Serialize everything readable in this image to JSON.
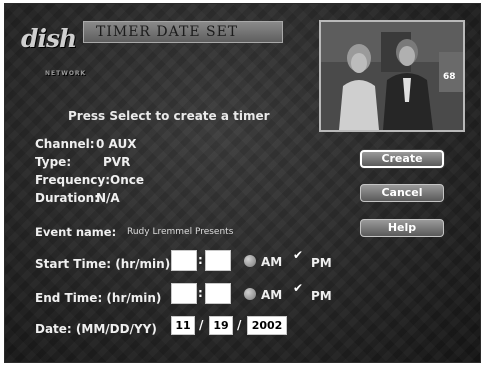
{
  "logo": {
    "text": "dish",
    "sub": "NETWORK"
  },
  "title": "TIMER DATE SET",
  "prompt": "Press Select to create a timer",
  "info": [
    {
      "label": "Channel:",
      "value": "0 AUX"
    },
    {
      "label": "Type:",
      "value": "PVR"
    },
    {
      "label": "Frequency:",
      "value": "Once"
    },
    {
      "label": "Duration:",
      "value": "N/A"
    }
  ],
  "event": {
    "label": "Event name:",
    "value": "Rudy Lremmel Presents"
  },
  "start_time": {
    "label": "Start Time: (hr/min)",
    "hour": "",
    "minute": "",
    "am": "AM",
    "pm": "PM",
    "selected": "PM"
  },
  "end_time": {
    "label": "End Time: (hr/min)",
    "hour": "",
    "minute": "",
    "am": "AM",
    "pm": "PM",
    "selected": "PM"
  },
  "date": {
    "label": "Date: (MM/DD/YY)",
    "month": "11",
    "day": "19",
    "year": "2002",
    "sep": "/"
  },
  "buttons": {
    "create": "Create",
    "cancel": "Cancel",
    "help": "Help"
  },
  "time_sep": ":",
  "check_mark": "✔"
}
